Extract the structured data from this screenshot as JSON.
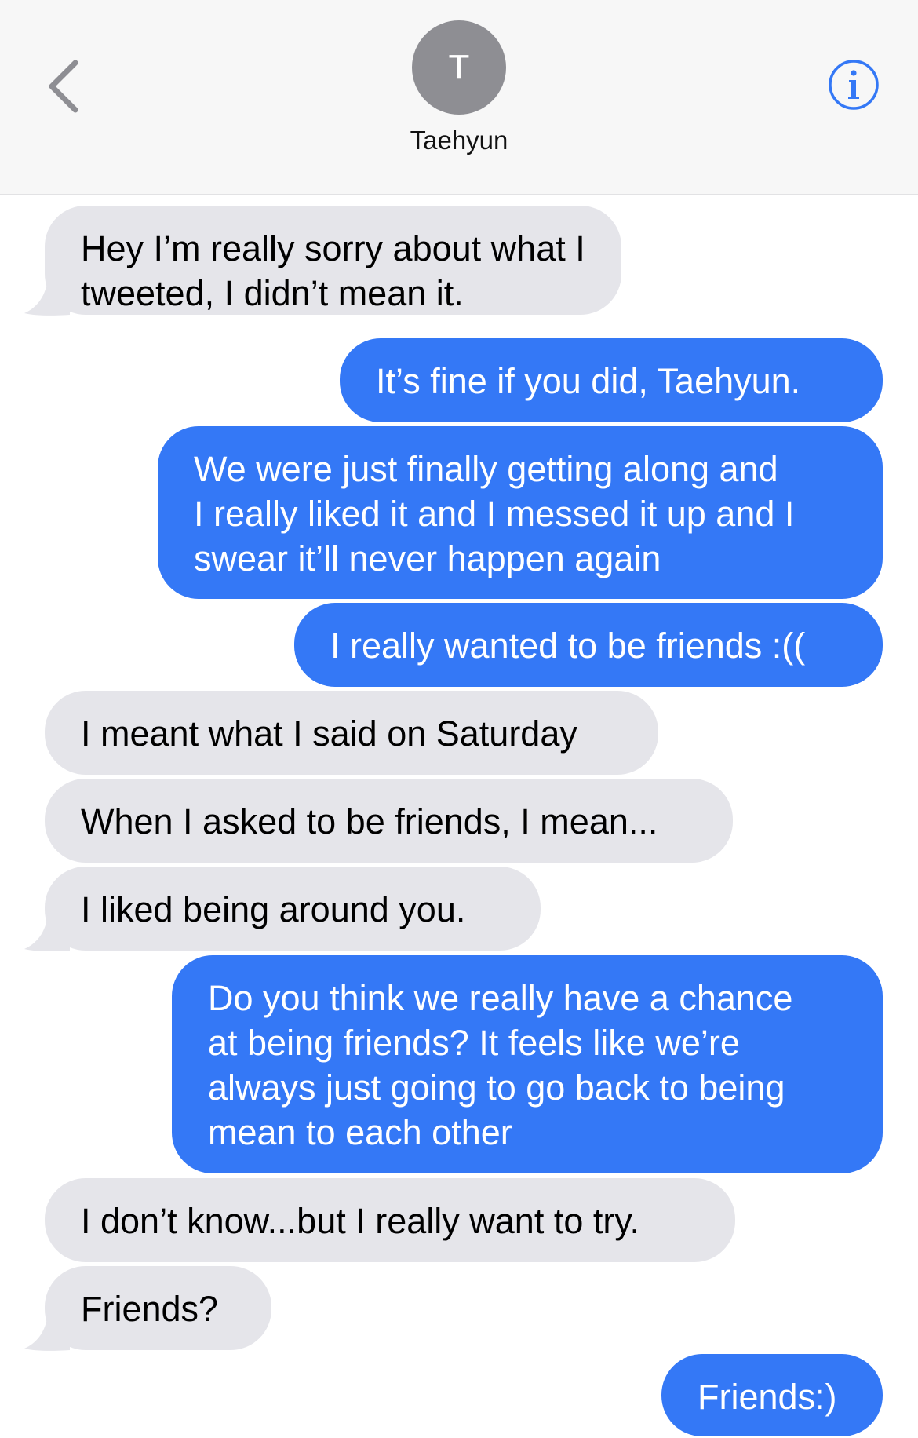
{
  "header": {
    "contact_initial": "T",
    "contact_name": "Taehyun"
  },
  "colors": {
    "incoming_bubble": "#e5e5ea",
    "outgoing_bubble": "#3478f6",
    "accent": "#3478f6",
    "avatar": "#8e8e93"
  },
  "icons": {
    "back": "chevron-left-icon",
    "info": "info-circle-icon"
  },
  "messages": [
    {
      "direction": "incoming",
      "text": "Hey I’m really sorry about what I\ntweeted, I didn’t mean it."
    },
    {
      "direction": "outgoing",
      "text": "It’s fine if you did, Taehyun."
    },
    {
      "direction": "outgoing",
      "text": "We were just finally getting along and\nI really liked it and I messed it up and I\nswear it’ll never happen again"
    },
    {
      "direction": "outgoing",
      "text": "I really wanted to be friends :(("
    },
    {
      "direction": "incoming",
      "text": "I meant what I said on Saturday"
    },
    {
      "direction": "incoming",
      "text": "When I asked to be friends, I mean..."
    },
    {
      "direction": "incoming",
      "text": "I liked being around you."
    },
    {
      "direction": "outgoing",
      "text": "Do you think we really have a chance\nat being friends? It feels like we’re\nalways just going to go back to being\nmean to each other"
    },
    {
      "direction": "incoming",
      "text": "I don’t know...but I really want to try."
    },
    {
      "direction": "incoming",
      "text": "Friends?"
    },
    {
      "direction": "outgoing",
      "text": "Friends:)"
    }
  ]
}
